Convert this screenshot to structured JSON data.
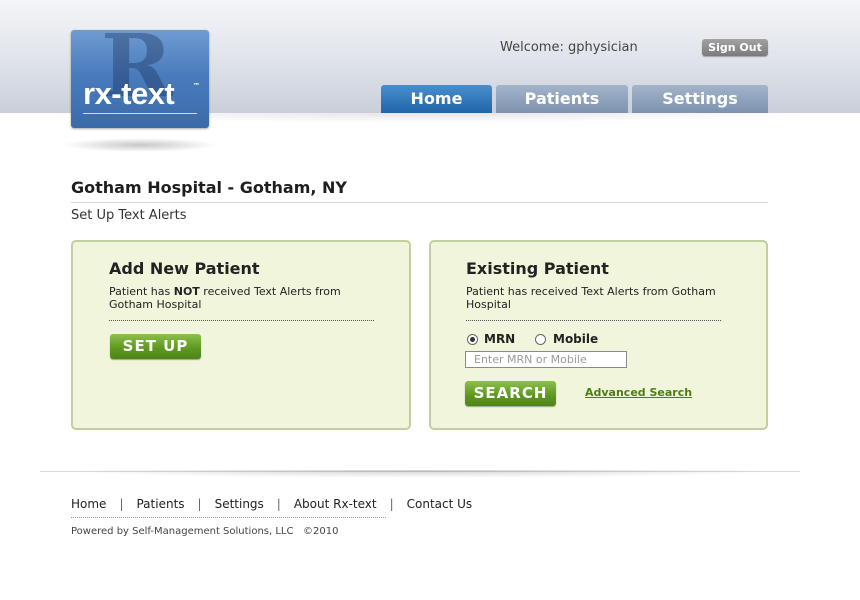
{
  "header": {
    "logo_text": "rx-text",
    "logo_tm": "™",
    "logo_watermark": "R",
    "welcome_label": "Welcome: gphysician",
    "signout_label": "Sign Out"
  },
  "nav": {
    "tabs": [
      {
        "label": "Home",
        "active": true
      },
      {
        "label": "Patients",
        "active": false
      },
      {
        "label": "Settings",
        "active": false
      }
    ]
  },
  "main": {
    "title": "Gotham Hospital - Gotham, NY",
    "subtitle": "Set Up Text Alerts"
  },
  "add_panel": {
    "heading": "Add New Patient",
    "desc_prefix": "Patient has ",
    "desc_bold": "NOT",
    "desc_suffix": " received Text Alerts from Gotham Hospital",
    "button_label": "SET UP"
  },
  "existing_panel": {
    "heading": "Existing Patient",
    "desc": "Patient has received Text Alerts from Gotham Hospital",
    "radio_mrn_label": "MRN",
    "radio_mobile_label": "Mobile",
    "selected_radio": "MRN",
    "input_placeholder": "Enter MRN or Mobile",
    "input_value": "",
    "search_button_label": "SEARCH",
    "advanced_search_label": "Advanced Search"
  },
  "footer": {
    "links": [
      "Home",
      "Patients",
      "Settings",
      "About Rx-text",
      "Contact Us"
    ],
    "separator": "|",
    "copyright": "Powered by Self-Management Solutions, LLC   ©2010"
  },
  "colors": {
    "active_tab": "#1f65a8",
    "inactive_tab": "#7d92af",
    "panel_bg": "#f1f5dc",
    "panel_border": "#c2cf9e",
    "green_button": "#5f9a22",
    "link_green": "#4d7d12"
  }
}
